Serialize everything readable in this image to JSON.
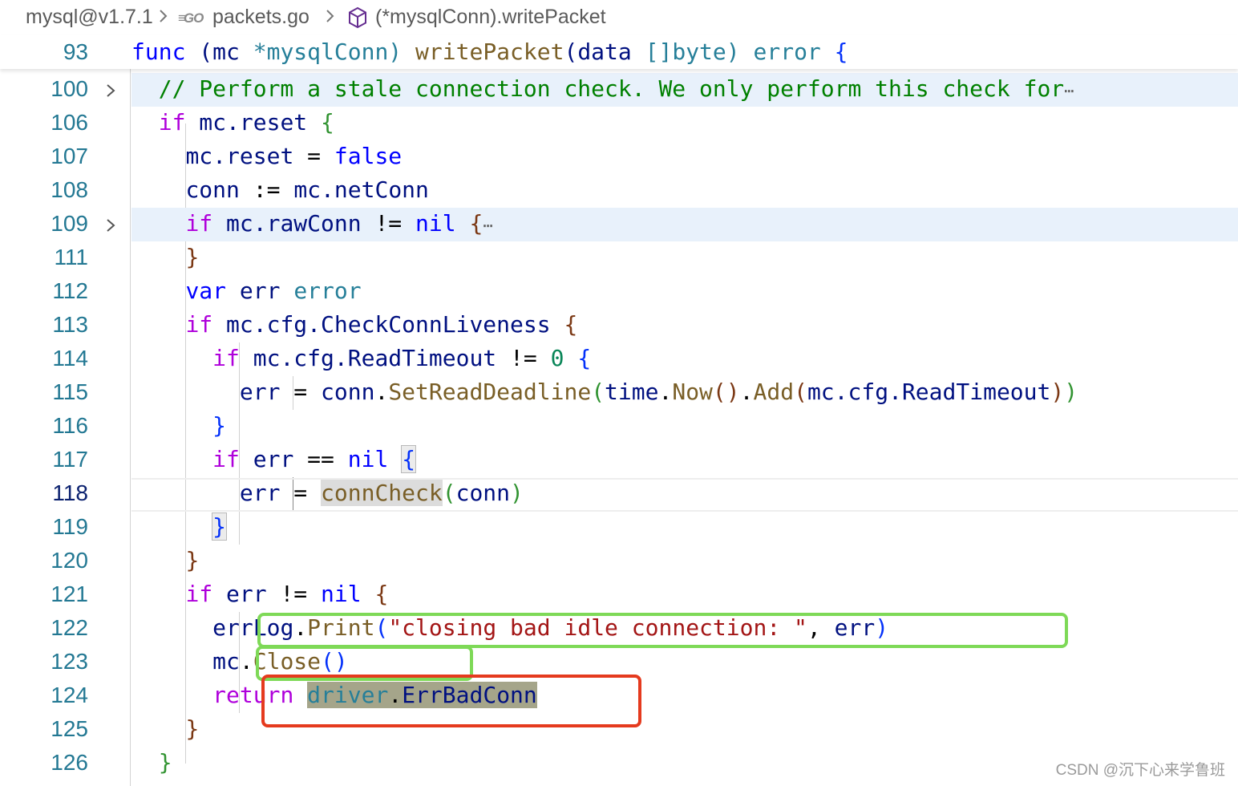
{
  "breadcrumb": {
    "module": "mysql@v1.7.1",
    "go_badge": "GO",
    "file": "packets.go",
    "symbol": "(*mysqlConn).writePacket"
  },
  "sticky": {
    "line_number": "93",
    "tokens": [
      "func",
      "(mc",
      "*mysqlConn)",
      "writePacket",
      "(data",
      "[]byte)",
      "error",
      "{"
    ]
  },
  "lines": [
    {
      "n": "100",
      "folded": true
    },
    {
      "n": "106"
    },
    {
      "n": "107"
    },
    {
      "n": "108"
    },
    {
      "n": "109",
      "folded": true
    },
    {
      "n": "111"
    },
    {
      "n": "112"
    },
    {
      "n": "113"
    },
    {
      "n": "114"
    },
    {
      "n": "115"
    },
    {
      "n": "116"
    },
    {
      "n": "117"
    },
    {
      "n": "118",
      "current": true
    },
    {
      "n": "119"
    },
    {
      "n": "120"
    },
    {
      "n": "121"
    },
    {
      "n": "122"
    },
    {
      "n": "123"
    },
    {
      "n": "124"
    },
    {
      "n": "125"
    },
    {
      "n": "126"
    }
  ],
  "code": {
    "l100": "// Perform a stale connection check. We only perform this check for",
    "l106": {
      "kw": "if",
      "expr": "mc.reset",
      "open": "{"
    },
    "l107": {
      "lhs": "mc.reset",
      "op": "=",
      "rhs": "false"
    },
    "l108": {
      "lhs": "conn",
      "op": ":=",
      "rhs": "mc.netConn"
    },
    "l109": {
      "kw": "if",
      "expr": "mc.rawConn",
      "op": "!=",
      "rhs": "nil",
      "open": "{"
    },
    "l111": "}",
    "l112": {
      "kw": "var",
      "name": "err",
      "type": "error"
    },
    "l113": {
      "kw": "if",
      "expr": "mc.cfg.CheckConnLiveness",
      "open": "{"
    },
    "l114": {
      "kw": "if",
      "expr": "mc.cfg.ReadTimeout",
      "op": "!=",
      "num": "0",
      "open": "{"
    },
    "l115": {
      "lhs": "err",
      "op": "=",
      "obj": "conn",
      "fn": "SetReadDeadline",
      "a1": "time",
      "f1": "Now",
      "f2": "Add",
      "a2": "mc.cfg.ReadTimeout"
    },
    "l116": "}",
    "l117": {
      "kw": "if",
      "expr": "err",
      "op": "==",
      "rhs": "nil",
      "open": "{"
    },
    "l118": {
      "lhs": "err",
      "op": "=",
      "fn": "connCheck",
      "arg": "conn"
    },
    "l119": "}",
    "l120": "}",
    "l121": {
      "kw": "if",
      "expr": "err",
      "op": "!=",
      "rhs": "nil",
      "open": "{"
    },
    "l122": {
      "obj": "errLog",
      "fn": "Print",
      "str": "\"closing bad idle connection: \"",
      "arg": "err"
    },
    "l123": {
      "obj": "mc",
      "fn": "Close"
    },
    "l124": {
      "kw": "return",
      "pkg": "driver",
      "name": "ErrBadConn"
    },
    "l125": "}",
    "l126": "}"
  },
  "watermark": "CSDN @沉下心来学鲁班",
  "annotation_colors": {
    "green": "#7ed957",
    "red": "#e53a1e"
  }
}
